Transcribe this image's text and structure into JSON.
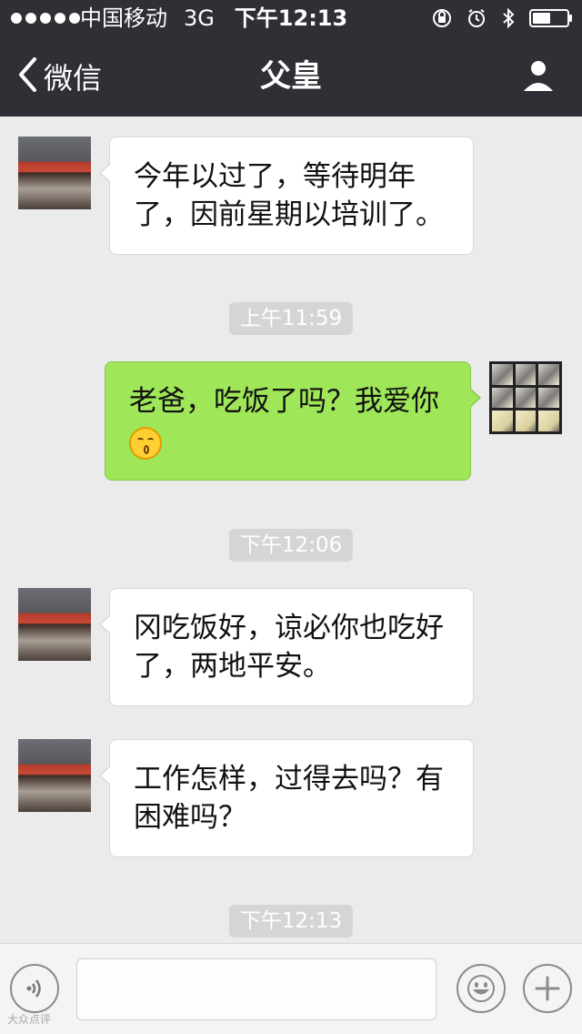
{
  "status_bar": {
    "carrier": "中国移动",
    "network": "3G",
    "time": "下午12:13",
    "icons": [
      "orientation-lock-icon",
      "alarm-icon",
      "bluetooth-icon",
      "battery-icon"
    ]
  },
  "nav": {
    "back_label": "微信",
    "title": "父皇",
    "icons": [
      "back-chevron-icon",
      "profile-icon"
    ]
  },
  "messages": [
    {
      "direction": "incoming",
      "text": "今年以过了，等待明年了，因前星期以培训了。"
    },
    {
      "type": "timestamp",
      "text": "上午11:59"
    },
    {
      "direction": "outgoing",
      "text": "老爸，吃饭了吗？我爱你",
      "emoji": "kissing-face-emoji"
    },
    {
      "type": "timestamp",
      "text": "下午12:06"
    },
    {
      "direction": "incoming",
      "text": "冈吃饭好，谅必你也吃好了，两地平安。"
    },
    {
      "direction": "incoming",
      "text": "工作怎样，过得去吗？有困难吗？"
    },
    {
      "type": "timestamp",
      "text": "下午12:13"
    }
  ],
  "input_bar": {
    "message_value": "",
    "icons": [
      "voice-icon",
      "emoji-smile-icon",
      "plus-icon"
    ]
  },
  "watermark": "大众点评",
  "colors": {
    "header_bg": "#2f2f35",
    "chat_bg": "#ebebeb",
    "incoming_bubble": "#ffffff",
    "outgoing_bubble": "#9fe658",
    "timestamp_bg": "#d5d5d5"
  }
}
